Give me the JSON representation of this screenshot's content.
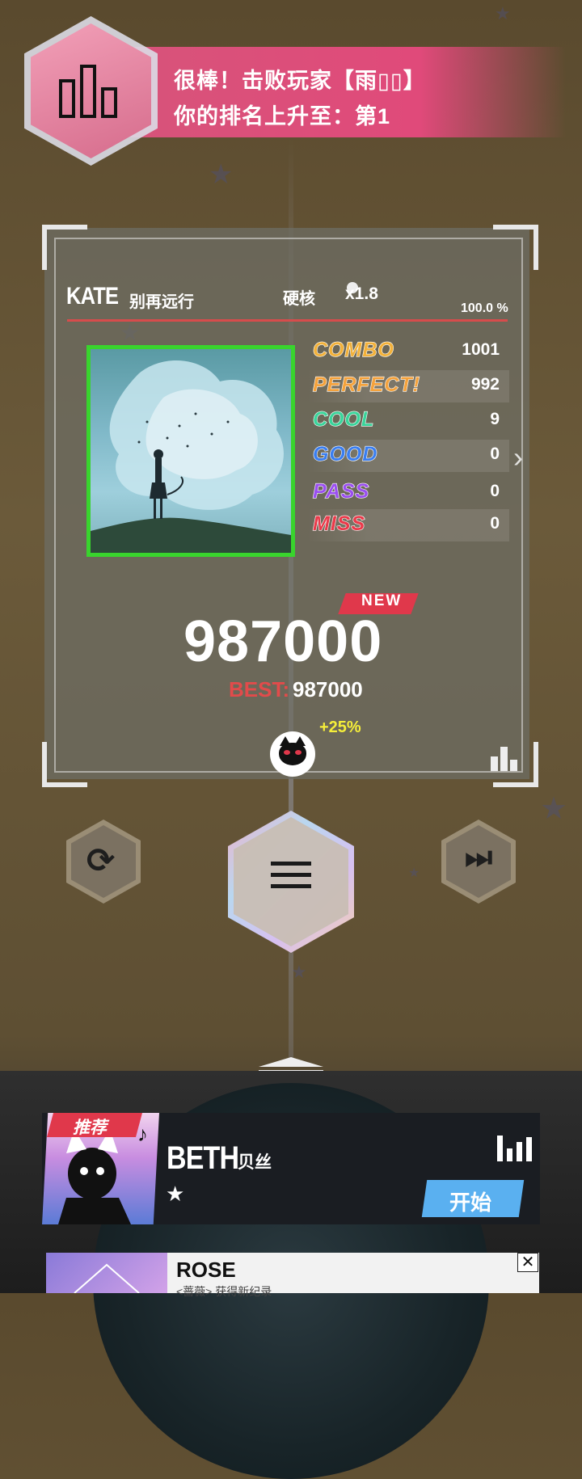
{
  "notification": {
    "line1": "很棒！击败玩家【雨▯▯】",
    "line2": "你的排名上升至：第1"
  },
  "song": {
    "artist": "KATE",
    "title": "别再远行",
    "difficulty": "硬核",
    "speed": "x1.8",
    "accuracy": "100.0 %"
  },
  "judgements": [
    {
      "label": "COMBO",
      "value": "1001",
      "color": "#f2b13a"
    },
    {
      "label": "PERFECT!",
      "value": "992",
      "color": "#f4a23c"
    },
    {
      "label": "COOL",
      "value": "9",
      "color": "#3ad49a"
    },
    {
      "label": "GOOD",
      "value": "0",
      "color": "#3a7ef0"
    },
    {
      "label": "PASS",
      "value": "0",
      "color": "#9a4ef0"
    },
    {
      "label": "MISS",
      "value": "0",
      "color": "#ea3a4a"
    }
  ],
  "result": {
    "new_label": "NEW",
    "score": "987000",
    "best_label": "BEST:",
    "best_value": "987000",
    "bonus": "+25%"
  },
  "controls": {
    "retry_icon": "retry-icon",
    "menu_icon": "menu-icon",
    "next_icon": "skip-next-icon"
  },
  "recommend": {
    "tag": "推荐",
    "name": "BETH",
    "subtitle": "贝丝",
    "stars": "★",
    "start_label": "开始"
  },
  "next_card": {
    "name": "ROSE",
    "subtitle": "<蔷薇> 获得新纪录",
    "close": "✕"
  }
}
